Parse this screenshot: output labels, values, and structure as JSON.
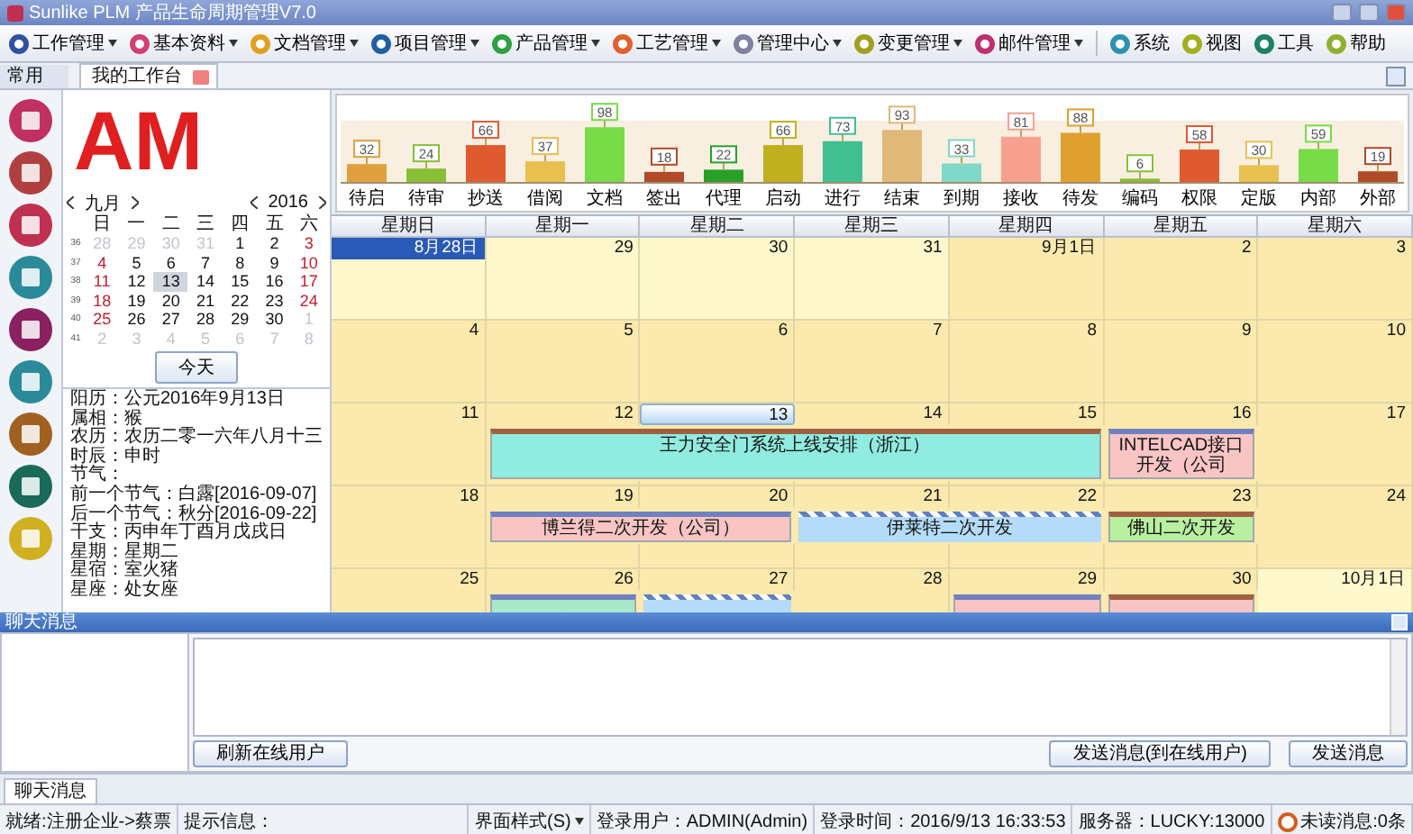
{
  "window": {
    "title": "Sunlike PLM 产品生命周期管理V7.0"
  },
  "menu": [
    {
      "label": "工作管理",
      "dropdown": true
    },
    {
      "label": "基本资料",
      "dropdown": true
    },
    {
      "label": "文档管理",
      "dropdown": true
    },
    {
      "label": "项目管理",
      "dropdown": true
    },
    {
      "label": "产品管理",
      "dropdown": true
    },
    {
      "label": "工艺管理",
      "dropdown": true
    },
    {
      "label": "管理中心",
      "dropdown": true
    },
    {
      "label": "变更管理",
      "dropdown": true
    },
    {
      "label": "邮件管理",
      "dropdown": true
    },
    {
      "label": "系统",
      "dropdown": false
    },
    {
      "label": "视图",
      "dropdown": false
    },
    {
      "label": "工具",
      "dropdown": false
    },
    {
      "label": "帮助",
      "dropdown": false
    }
  ],
  "left_tab": {
    "label": "常用"
  },
  "tabs": [
    {
      "label": "我的工作台",
      "selected": true
    }
  ],
  "logo": {
    "text": "AM"
  },
  "mini_calendar": {
    "month": "九月",
    "year": "2016",
    "weekdays": [
      "日",
      "一",
      "二",
      "三",
      "四",
      "五",
      "六"
    ],
    "weeks": [
      {
        "number": "36",
        "days": [
          {
            "label": "28",
            "other_month": true,
            "selected": false
          },
          {
            "label": "29",
            "other_month": true,
            "selected": false
          },
          {
            "label": "30",
            "other_month": true,
            "selected": false
          },
          {
            "label": "31",
            "other_month": true,
            "selected": false
          },
          {
            "label": "1",
            "other_month": false,
            "selected": false
          },
          {
            "label": "2",
            "other_month": false,
            "selected": false
          },
          {
            "label": "3",
            "other_month": false,
            "selected": false
          }
        ]
      },
      {
        "number": "37",
        "days": [
          {
            "label": "4",
            "other_month": false,
            "selected": false
          },
          {
            "label": "5",
            "other_month": false,
            "selected": false
          },
          {
            "label": "6",
            "other_month": false,
            "selected": false
          },
          {
            "label": "7",
            "other_month": false,
            "selected": false
          },
          {
            "label": "8",
            "other_month": false,
            "selected": false
          },
          {
            "label": "9",
            "other_month": false,
            "selected": false
          },
          {
            "label": "10",
            "other_month": false,
            "selected": false
          }
        ]
      },
      {
        "number": "38",
        "days": [
          {
            "label": "11",
            "other_month": false,
            "selected": false
          },
          {
            "label": "12",
            "other_month": false,
            "selected": false
          },
          {
            "label": "13",
            "other_month": false,
            "selected": true
          },
          {
            "label": "14",
            "other_month": false,
            "selected": false
          },
          {
            "label": "15",
            "other_month": false,
            "selected": false
          },
          {
            "label": "16",
            "other_month": false,
            "selected": false
          },
          {
            "label": "17",
            "other_month": false,
            "selected": false
          }
        ]
      },
      {
        "number": "39",
        "days": [
          {
            "label": "18",
            "other_month": false,
            "selected": false
          },
          {
            "label": "19",
            "other_month": false,
            "selected": false
          },
          {
            "label": "20",
            "other_month": false,
            "selected": false
          },
          {
            "label": "21",
            "other_month": false,
            "selected": false
          },
          {
            "label": "22",
            "other_month": false,
            "selected": false
          },
          {
            "label": "23",
            "other_month": false,
            "selected": false
          },
          {
            "label": "24",
            "other_month": false,
            "selected": false
          }
        ]
      },
      {
        "number": "40",
        "days": [
          {
            "label": "25",
            "other_month": false,
            "selected": false
          },
          {
            "label": "26",
            "other_month": false,
            "selected": false
          },
          {
            "label": "27",
            "other_month": false,
            "selected": false
          },
          {
            "label": "28",
            "other_month": false,
            "selected": false
          },
          {
            "label": "29",
            "other_month": false,
            "selected": false
          },
          {
            "label": "30",
            "other_month": false,
            "selected": false
          },
          {
            "label": "1",
            "other_month": true,
            "selected": false
          }
        ]
      },
      {
        "number": "41",
        "days": [
          {
            "label": "2",
            "other_month": true,
            "selected": false
          },
          {
            "label": "3",
            "other_month": true,
            "selected": false
          },
          {
            "label": "4",
            "other_month": true,
            "selected": false
          },
          {
            "label": "5",
            "other_month": true,
            "selected": false
          },
          {
            "label": "6",
            "other_month": true,
            "selected": false
          },
          {
            "label": "7",
            "other_month": true,
            "selected": false
          },
          {
            "label": "8",
            "other_month": true,
            "selected": false
          }
        ]
      }
    ]
  },
  "today_button": "今天",
  "info_lines": [
    "阳历：公元2016年9月13日",
    "属相：猴",
    "农历：农历二零一六年八月十三",
    "时辰：申时",
    "节气：",
    "前一个节气：白露[2016-09-07]",
    "后一个节气：秋分[2016-09-22]",
    "干支：丙申年丁酉月戊戌日",
    "星期：星期二",
    "星宿：室火猪",
    "星座：处女座"
  ],
  "chart": {
    "chart_data": {
      "type": "bar",
      "categories": [
        "待启",
        "待审",
        "抄送",
        "借阅",
        "文档",
        "签出",
        "代理",
        "启动",
        "进行",
        "结束",
        "到期",
        "接收",
        "待发",
        "编码",
        "权限",
        "定版",
        "内部",
        "外部"
      ],
      "values": [
        32,
        24,
        66,
        37,
        98,
        18,
        22,
        66,
        73,
        93,
        33,
        81,
        88,
        6,
        58,
        30,
        59,
        19
      ],
      "data_labels": true
    }
  },
  "calendar": {
    "columns": [
      "星期日",
      "星期一",
      "星期二",
      "星期三",
      "星期四",
      "星期五",
      "星期六"
    ],
    "weeks": [
      {
        "days": [
          {
            "label": "8月28日",
            "other_month": true,
            "selected": true,
            "today": false
          },
          {
            "label": "29",
            "other_month": true,
            "selected": false,
            "today": false
          },
          {
            "label": "30",
            "other_month": true,
            "selected": false,
            "today": false
          },
          {
            "label": "31",
            "other_month": true,
            "selected": false,
            "today": false
          },
          {
            "label": "9月1日",
            "other_month": false,
            "selected": false,
            "today": false
          },
          {
            "label": "2",
            "other_month": false,
            "selected": false,
            "today": false
          },
          {
            "label": "3",
            "other_month": false,
            "selected": false,
            "today": false
          }
        ]
      },
      {
        "days": [
          {
            "label": "4",
            "other_month": false,
            "selected": false,
            "today": false
          },
          {
            "label": "5",
            "other_month": false,
            "selected": false,
            "today": false
          },
          {
            "label": "6",
            "other_month": false,
            "selected": false,
            "today": false
          },
          {
            "label": "7",
            "other_month": false,
            "selected": false,
            "today": false
          },
          {
            "label": "8",
            "other_month": false,
            "selected": false,
            "today": false
          },
          {
            "label": "9",
            "other_month": false,
            "selected": false,
            "today": false
          },
          {
            "label": "10",
            "other_month": false,
            "selected": false,
            "today": false
          }
        ]
      },
      {
        "days": [
          {
            "label": "11",
            "other_month": false,
            "selected": false,
            "today": false
          },
          {
            "label": "12",
            "other_month": false,
            "selected": false,
            "today": false
          },
          {
            "label": "13",
            "other_month": false,
            "selected": false,
            "today": true
          },
          {
            "label": "14",
            "other_month": false,
            "selected": false,
            "today": false
          },
          {
            "label": "15",
            "other_month": false,
            "selected": false,
            "today": false
          },
          {
            "label": "16",
            "other_month": false,
            "selected": false,
            "today": false
          },
          {
            "label": "17",
            "other_month": false,
            "selected": false,
            "today": false
          }
        ],
        "lane": [
          {
            "kind": "empty"
          },
          {
            "kind": "brown",
            "label": "王力安全门系统上线安排（浙江）",
            "color": "#90ebe0"
          },
          {
            "kind": "continued"
          },
          {
            "kind": "continued"
          },
          {
            "kind": "continued"
          },
          {
            "kind": "blue",
            "label": "INTELCAD接口开发（公司",
            "color": "#f8c4c4"
          },
          {
            "kind": "empty"
          }
        ]
      },
      {
        "days": [
          {
            "label": "18",
            "other_month": false,
            "selected": false,
            "today": false
          },
          {
            "label": "19",
            "other_month": false,
            "selected": false,
            "today": false
          },
          {
            "label": "20",
            "other_month": false,
            "selected": false,
            "today": false
          },
          {
            "label": "21",
            "other_month": false,
            "selected": false,
            "today": false
          },
          {
            "label": "22",
            "other_month": false,
            "selected": false,
            "today": false
          },
          {
            "label": "23",
            "other_month": false,
            "selected": false,
            "today": false
          },
          {
            "label": "24",
            "other_month": false,
            "selected": false,
            "today": false
          }
        ],
        "lane": [
          {
            "kind": "empty"
          },
          {
            "kind": "blue",
            "label": "博兰得二次开发（公司）",
            "color": "#f8c4c4"
          },
          {
            "kind": "continued"
          },
          {
            "kind": "striped",
            "label": "伊莱特二次开发",
            "color": "#b4dcf8"
          },
          {
            "kind": "continued"
          },
          {
            "kind": "brown",
            "label": "佛山二次开发",
            "color": "#b8f0a0"
          },
          {
            "kind": "empty"
          }
        ]
      },
      {
        "days": [
          {
            "label": "25",
            "other_month": false,
            "selected": false,
            "today": false
          },
          {
            "label": "26",
            "other_month": false,
            "selected": false,
            "today": false
          },
          {
            "label": "27",
            "other_month": false,
            "selected": false,
            "today": false
          },
          {
            "label": "28",
            "other_month": false,
            "selected": false,
            "today": false
          },
          {
            "label": "29",
            "other_month": false,
            "selected": false,
            "today": false
          },
          {
            "label": "30",
            "other_month": false,
            "selected": false,
            "today": false
          },
          {
            "label": "10月1日",
            "other_month": true,
            "selected": false,
            "today": false
          }
        ],
        "lane": [
          {
            "kind": "empty"
          },
          {
            "kind": "blue",
            "color": "#a8e8c8"
          },
          {
            "kind": "striped",
            "color": "#b4dcf8"
          },
          {
            "kind": "empty"
          },
          {
            "kind": "blue",
            "color": "#f8c4c4"
          },
          {
            "kind": "brown",
            "color": "#f8c4c4"
          },
          {
            "kind": "empty"
          }
        ]
      }
    ]
  },
  "chat": {
    "title": "聊天消息",
    "refresh_button": "刷新在线用户",
    "send_online_button": "发送消息(到在线用户)",
    "send_button": "发送消息",
    "tab": "聊天消息"
  },
  "status_bar": [
    {
      "kind": "text",
      "label": "就绪:注册企业->蔡票"
    },
    {
      "kind": "hint",
      "label": "提示信息："
    },
    {
      "kind": "menu",
      "label": "界面样式(S)"
    },
    {
      "kind": "text",
      "label": "登录用户：ADMIN(Admin)"
    },
    {
      "kind": "text",
      "label": "登录时间：2016/9/13 16:33:53"
    },
    {
      "kind": "text",
      "label": "服务器：LUCKY:13000"
    },
    {
      "kind": "mail",
      "label": "未读消息:0条"
    }
  ]
}
